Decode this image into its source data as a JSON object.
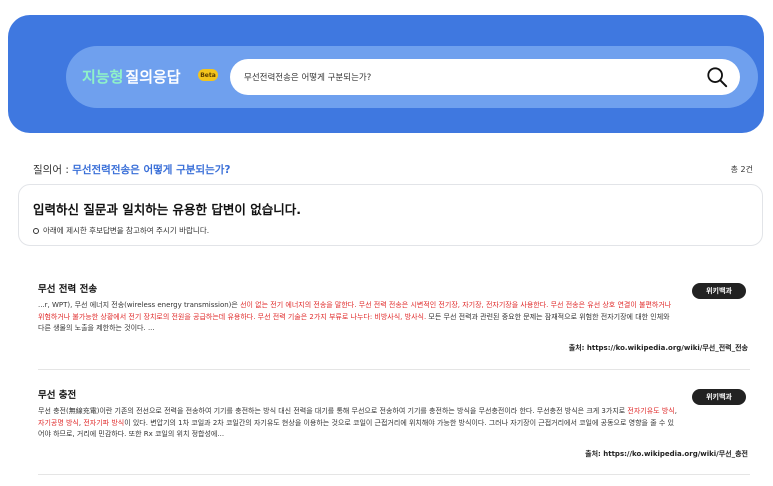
{
  "header": {
    "brand_part1": "지능형",
    "brand_part2": "질의응답",
    "beta_badge": "Beta",
    "search_value": "무선전력전송은 어떻게 구분되는가?"
  },
  "query": {
    "label": "질의어 : ",
    "text": "무선전력전송은 어떻게 구분되는가?",
    "total": "총 2건"
  },
  "notice": {
    "title": "입력하신 질문과 일치하는 유용한 답변이 없습니다.",
    "subtitle": "아래에 제시한 후보답변을 참고하여 주시기 바랍니다."
  },
  "results": [
    {
      "title": "무선 전력 전송",
      "badge": "위키백과",
      "body_parts": [
        {
          "text": "...r, WPT), 무선 에너지 전송(wireless energy transmission)은 ",
          "hl": false
        },
        {
          "text": "선이 없는 전기 에너지의 전송을 말한다. 무선 전력 전송은 시변적인 전기장, 자기장, 전자기장을 사용한다. 무선 전송은 유선 상호 연결이 불편하거나 위험하거나 불가능한 상황에서 전기 장치로의 전원을 공급하는데 유용하다. 무선 전력 기술은 2가지 부류로 나누다: 비방사식, 방사식.",
          "hl": true
        },
        {
          "text": " 모든 무선 전력과 관련된 중요한 문제는 잠재적으로 위험한 전자기장에 대한 인체와 다른 생물의 노출을 제한하는 것이다. ...",
          "hl": false
        }
      ],
      "source": "출처: https://ko.wikipedia.org/wiki/무선_전력_전송"
    },
    {
      "title": "무선 충전",
      "badge": "위키백과",
      "body_parts": [
        {
          "text": "무선 충전(無線充電)이란 기존의 전선으로 전력을 전송하여 기기를 충전하는 방식 대신 전력을 대기를 통해 무선으로 전송하여 기기를 충전하는 방식을 무선충전이라 한다. 무선충전 방식은 크게 3가지로 ",
          "hl": false
        },
        {
          "text": "전자기유도 방식",
          "hl": true
        },
        {
          "text": ", ",
          "hl": false
        },
        {
          "text": "자기공명 방식",
          "hl": true
        },
        {
          "text": ", ",
          "hl": false
        },
        {
          "text": "전자기파 방식",
          "hl": true
        },
        {
          "text": "이 있다. 변압기의 1차 코일과 2차 코일간의 자기유도 현상을 이용하는 것으로 코일이 근접거리에 위치해야 가능한 방식이다. 그러나 자기장이 근접거리에서 코일에 공동으로 영향을 줄 수 있어야 하므로, 거리에 민감하다. 또한 Rx 코일의 위치 정합성에...",
          "hl": false
        }
      ],
      "source": "출처: https://ko.wikipedia.org/wiki/무선_충전"
    }
  ],
  "colors": {
    "hero": "#3f78e0",
    "search_bar": "#6fa0ee",
    "brand_accent": "#8ff2c8",
    "highlight": "#e02b2b",
    "query_accent": "#3a6fd8"
  }
}
